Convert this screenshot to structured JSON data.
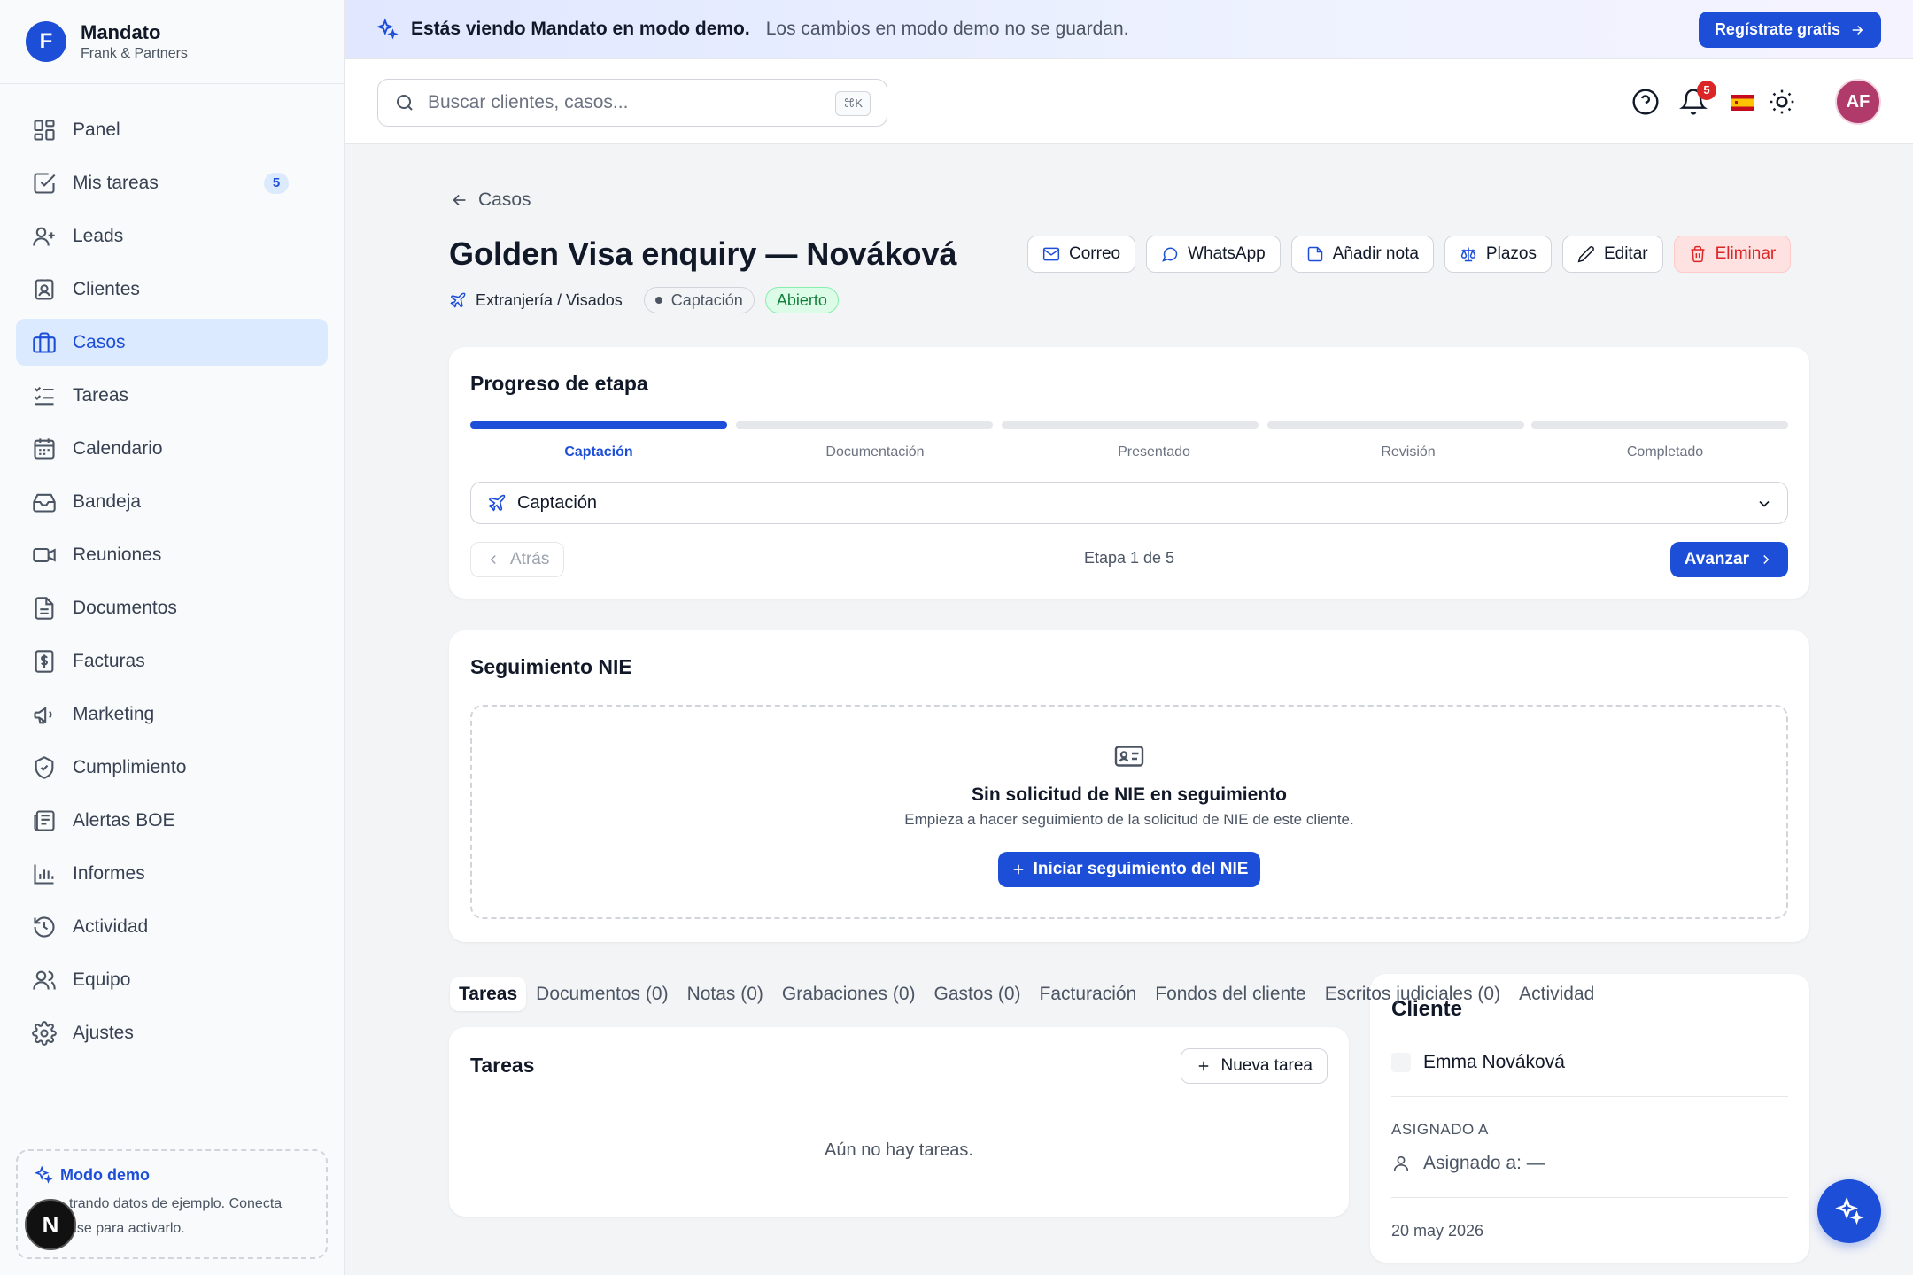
{
  "brand": {
    "initial": "F",
    "name": "Mandato",
    "firm": "Frank & Partners"
  },
  "sidebar": {
    "items": [
      {
        "label": "Panel",
        "icon": "grid-icon"
      },
      {
        "label": "Mis tareas",
        "icon": "check-square-icon",
        "badge": "5"
      },
      {
        "label": "Leads",
        "icon": "user-plus-icon"
      },
      {
        "label": "Clientes",
        "icon": "contact-icon"
      },
      {
        "label": "Casos",
        "icon": "briefcase-icon",
        "active": true
      },
      {
        "label": "Tareas",
        "icon": "list-checks-icon"
      },
      {
        "label": "Calendario",
        "icon": "calendar-icon"
      },
      {
        "label": "Bandeja",
        "icon": "inbox-icon"
      },
      {
        "label": "Reuniones",
        "icon": "video-icon"
      },
      {
        "label": "Documentos",
        "icon": "file-text-icon"
      },
      {
        "label": "Facturas",
        "icon": "receipt-icon"
      },
      {
        "label": "Marketing",
        "icon": "megaphone-icon"
      },
      {
        "label": "Cumplimiento",
        "icon": "shield-icon"
      },
      {
        "label": "Alertas BOE",
        "icon": "newspaper-icon"
      },
      {
        "label": "Informes",
        "icon": "bar-chart-icon"
      },
      {
        "label": "Actividad",
        "icon": "history-icon"
      },
      {
        "label": "Equipo",
        "icon": "users-icon"
      },
      {
        "label": "Ajustes",
        "icon": "settings-icon"
      }
    ],
    "demo": {
      "title": "Modo demo",
      "line1": "trando datos de ejemplo. Conecta",
      "line2": "ase para activarlo."
    },
    "n_badge": "N"
  },
  "banner": {
    "strong": "Estás viendo Mandato en modo demo.",
    "text": "Los cambios en modo demo no se guardan.",
    "cta": "Regístrate gratis"
  },
  "topbar": {
    "search_placeholder": "Buscar clientes, casos...",
    "shortcut": "⌘K",
    "notifications": "5",
    "avatar": "AF"
  },
  "case": {
    "back": "Casos",
    "title": "Golden Visa enquiry — Nováková",
    "area": "Extranjería / Visados",
    "stage_pill": "Captación",
    "status": "Abierto",
    "actions": [
      "Correo",
      "WhatsApp",
      "Añadir nota",
      "Plazos",
      "Editar",
      "Eliminar"
    ]
  },
  "progress": {
    "title": "Progreso de etapa",
    "stages": [
      "Captación",
      "Documentación",
      "Presentado",
      "Revisión",
      "Completado"
    ],
    "current_index": 0,
    "selected": "Captación",
    "back": "Atrás",
    "step_text": "Etapa 1 de 5",
    "next": "Avanzar"
  },
  "nie": {
    "title": "Seguimiento NIE",
    "heading": "Sin solicitud de NIE en seguimiento",
    "text": "Empieza a hacer seguimiento de la solicitud de NIE de este cliente.",
    "button": "Iniciar seguimiento del NIE"
  },
  "tabs": [
    "Tareas",
    "Documentos (0)",
    "Notas (0)",
    "Grabaciones (0)",
    "Gastos (0)",
    "Facturación",
    "Fondos del cliente",
    "Escritos judiciales (0)",
    "Actividad"
  ],
  "tasks": {
    "title": "Tareas",
    "new": "Nueva tarea",
    "empty": "Aún no hay tareas."
  },
  "client": {
    "title": "Cliente",
    "name": "Emma Nováková",
    "assigned_label": "ASIGNADO A",
    "assigned": "Asignado a: —",
    "date": "20 may 2026"
  },
  "colors": {
    "accent": "#1d4ed8",
    "danger": "#dc2626",
    "success": "#15803d"
  }
}
